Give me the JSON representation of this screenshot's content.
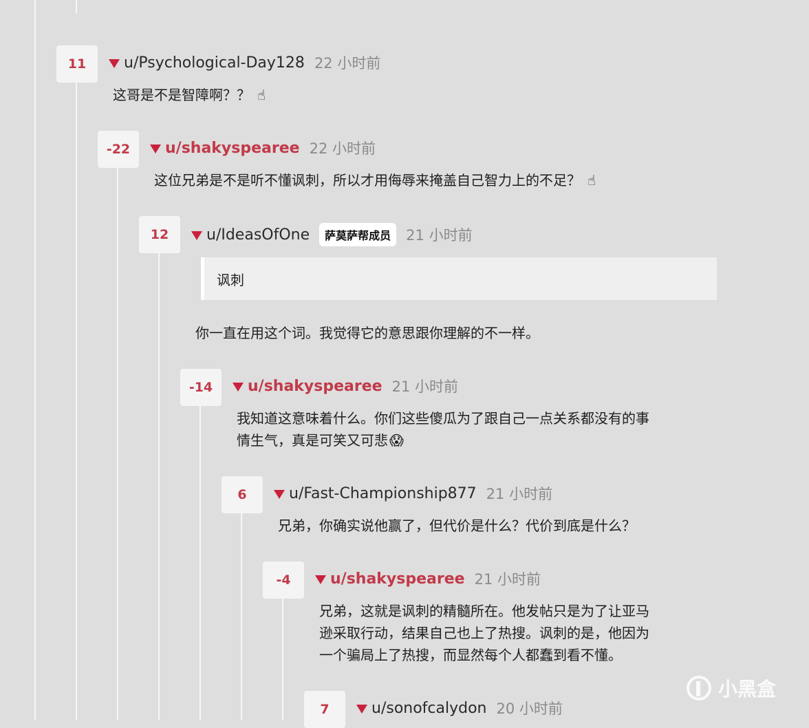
{
  "comments": [
    {
      "score": "11",
      "user": "u/Psychological-Day128",
      "time": "22 小时前",
      "text": "这哥是不是智障啊？？",
      "emoji": "☝"
    },
    {
      "score": "-22",
      "user": "u/shakyspearee",
      "time": "22 小时前",
      "text": "这位兄弟是不是听不懂讽刺，所以才用侮辱来掩盖自己智力上的不足？",
      "emoji": "☝"
    },
    {
      "score": "12",
      "user": "u/IdeasOfOne",
      "flair": "萨莫萨帮成员",
      "time": "21 小时前",
      "quote": "讽刺",
      "text": "你一直在用这个词。我觉得它的意思跟你理解的不一样。"
    },
    {
      "score": "-14",
      "user": "u/shakyspearee",
      "time": "21 小时前",
      "text_line1": "我知道这意味着什么。你们这些傻瓜为了跟自己一点关系都没有的事",
      "text_line2": "情生气，真是可笑又可悲",
      "emoji": "😱"
    },
    {
      "score": "6",
      "user": "u/Fast-Championship877",
      "time": "21 小时前",
      "text": "兄弟，你确实说他赢了，但代价是什么？代价到底是什么？"
    },
    {
      "score": "-4",
      "user": "u/shakyspearee",
      "time": "21 小时前",
      "text_line1": "兄弟，这就是讽刺的精髓所在。他发帖只是为了让亚马",
      "text_line2": "逊采取行动，结果自己也上了热搜。讽刺的是，他因为",
      "text_line3": "一个骗局上了热搜，而显然每个人都蠢到看不懂。"
    },
    {
      "score": "7",
      "user": "u/sonofcalydon",
      "time": "20 小时前"
    }
  ],
  "watermark": "小黑盒",
  "colors": {
    "accent": "#c23a4a",
    "background": "#dedede",
    "card": "#f4f4f4"
  }
}
